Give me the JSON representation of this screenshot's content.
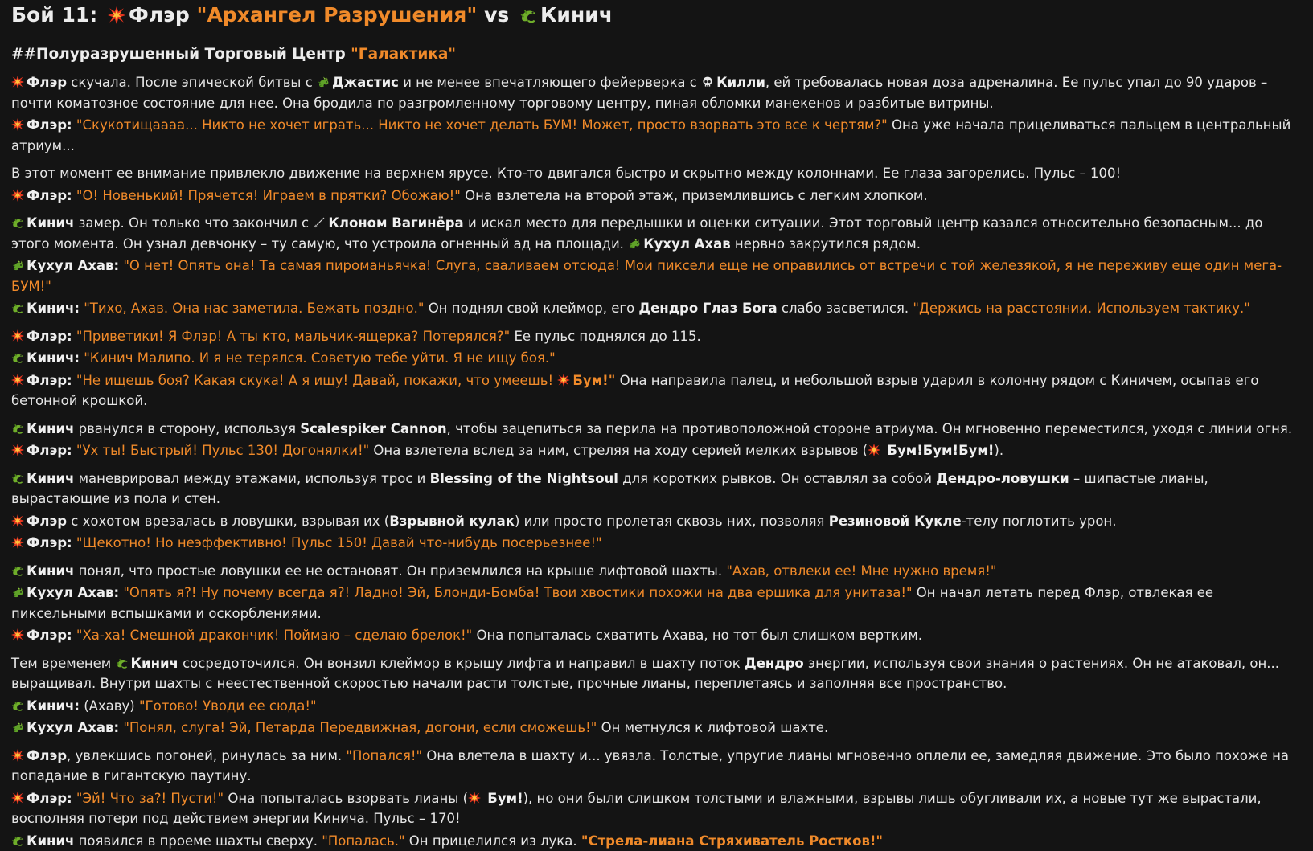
{
  "header": {
    "title_prefix": "Бой 11:",
    "fighter1": "Флэр",
    "fighter1_title": "\"Архангел Разрушения\"",
    "vs": "vs",
    "fighter2": "Кинич"
  },
  "location": {
    "prefix": "##Полуразрушенный Торговый Центр",
    "name": "\"Галактика\""
  },
  "icons": {
    "explosion": "explosion-icon",
    "lizard": "lizard-icon",
    "dragon": "dragon-icon",
    "skull": "skull-icon",
    "blade": "blade-icon"
  },
  "colors": {
    "accent": "#f08a2a",
    "text": "#e6e6e6",
    "background": "#141414"
  },
  "p1": {
    "l1a": "Флэр",
    "l1b": "скучала. После эпической битвы с",
    "l1c": "Джастис",
    "l1d": "и не менее впечатляющего фейерверка с",
    "l1e": "Килли",
    "l1f": ", ей требовалась новая доза адреналина. Ее пульс упал до 90 ударов – почти коматозное состояние для нее. Она бродила по разгромленному торговому центру, пиная обломки манекенов и разбитые витрины.",
    "l2a": "Флэр:",
    "l2b": "\"Скукотищаааа... Никто не хочет играть... Никто не хочет делать БУМ! Может, просто взорвать это все к чертям?\"",
    "l2c": "Она уже начала прицеливаться пальцем в центральный атриум..."
  },
  "p2": {
    "l1": "В этот момент ее внимание привлекло движение на верхнем ярусе. Кто-то двигался быстро и скрытно между колоннами. Ее глаза загорелись. Пульс – 100!",
    "l2a": "Флэр:",
    "l2b": "\"О! Новенький! Прячется! Играем в прятки? Обожаю!\"",
    "l2c": "Она взлетела на второй этаж, приземлившись с легким хлопком."
  },
  "p3": {
    "l1a": "Кинич",
    "l1b": "замер. Он только что закончил с",
    "l1c": "Клоном Вагинёра",
    "l1d": "и искал место для передышки и оценки ситуации. Этот торговый центр казался относительно безопасным... до этого момента. Он узнал девчонку – ту самую, что устроила огненный ад на площади.",
    "l1e": "Кухул Ахав",
    "l1f": "нервно закрутился рядом.",
    "l2a": "Кухул Ахав:",
    "l2b": "\"О нет! Опять она! Та самая пироманьячка! Слуга, сваливаем отсюда! Мои пиксели еще не оправились от встречи с той железякой, я не переживу еще один мега-БУМ!\"",
    "l3a": "Кинич:",
    "l3b": "\"Тихо, Ахав. Она нас заметила. Бежать поздно.\"",
    "l3c": "Он поднял свой клеймор, его",
    "l3d": "Дендро Глаз Бога",
    "l3e": "слабо засветился.",
    "l3f": "\"Держись на расстоянии. Используем тактику.\""
  },
  "p4": {
    "l1a": "Флэр:",
    "l1b": "\"Приветики! Я Флэр! А ты кто, мальчик-ящерка? Потерялся?\"",
    "l1c": "Ее пульс поднялся до 115.",
    "l2a": "Кинич:",
    "l2b": "\"Кинич Малипо. И я не терялся. Советую тебе уйти. Я не ищу боя.\"",
    "l3a": "Флэр:",
    "l3b": "\"Не ищешь боя? Какая скука! А я ищу! Давай, покажи, что умеешь!",
    "l3c": "Бум!\"",
    "l3d": "Она направила палец, и небольшой взрыв ударил в колонну рядом с Киничем, осыпав его бетонной крошкой."
  },
  "p5": {
    "l1a": "Кинич",
    "l1b": "рванулся в сторону, используя",
    "l1c": "Scalespiker Cannon",
    "l1d": ", чтобы зацепиться за перила на противоположной стороне атриума. Он мгновенно переместился, уходя с линии огня.",
    "l2a": "Флэр:",
    "l2b": "\"Ух ты! Быстрый! Пульс 130! Догонялки!\"",
    "l2c": "Она взлетела вслед за ним, стреляя на ходу серией мелких взрывов (",
    "l2d": "Бум!Бум!Бум!",
    "l2e": ")."
  },
  "p6": {
    "l1a": "Кинич",
    "l1b": "маневрировал между этажами, используя трос и",
    "l1c": "Blessing of the Nightsoul",
    "l1d": "для коротких рывков. Он оставлял за собой",
    "l1e": "Дендро-ловушки",
    "l1f": "– шипастые лианы, вырастающие из пола и стен.",
    "l2a": "Флэр",
    "l2b": "с хохотом врезалась в ловушки, взрывая их (",
    "l2c": "Взрывной кулак",
    "l2d": ") или просто пролетая сквозь них, позволяя",
    "l2e": "Резиновой Кукле",
    "l2f": "-телу поглотить урон.",
    "l3a": "Флэр:",
    "l3b": "\"Щекотно! Но неэффективно! Пульс 150! Давай что-нибудь посерьезнее!\""
  },
  "p7": {
    "l1a": "Кинич",
    "l1b": "понял, что простые ловушки ее не остановят. Он приземлился на крыше лифтовой шахты.",
    "l1c": "\"Ахав, отвлеки ее! Мне нужно время!\"",
    "l2a": "Кухул Ахав:",
    "l2b": "\"Опять я?! Ну почему всегда я?! Ладно! Эй, Блонди-Бомба! Твои хвостики похожи на два ершика для унитаза!\"",
    "l2c": "Он начал летать перед Флэр, отвлекая ее пиксельными вспышками и оскорблениями.",
    "l3a": "Флэр:",
    "l3b": "\"Ха-ха! Смешной дракончик! Поймаю – сделаю брелок!\"",
    "l3c": "Она попыталась схватить Ахава, но тот был слишком вертким."
  },
  "p8": {
    "l1a": "Тем временем",
    "l1b": "Кинич",
    "l1c": "сосредоточился. Он вонзил клеймор в крышу лифта и направил в шахту поток",
    "l1d": "Дендро",
    "l1e": "энергии, используя свои знания о растениях. Он не атаковал, он... выращивал. Внутри шахты с неестественной скоростью начали расти толстые, прочные лианы, переплетаясь и заполняя все пространство.",
    "l2a": "Кинич:",
    "l2b": "(Ахаву)",
    "l2c": "\"Готово! Уводи ее сюда!\"",
    "l3a": "Кухул Ахав:",
    "l3b": "\"Понял, слуга! Эй, Петарда Передвижная, догони, если сможешь!\"",
    "l3c": "Он метнулся к лифтовой шахте."
  },
  "p9": {
    "l1a": "Флэр",
    "l1b": ", увлекшись погоней, ринулась за ним.",
    "l1c": "\"Попался!\"",
    "l1d": "Она влетела в шахту и... увязла. Толстые, упругие лианы мгновенно оплели ее, замедляя движение. Это было похоже на попадание в гигантскую паутину.",
    "l2a": "Флэр:",
    "l2b": "\"Эй! Что за?! Пусти!\"",
    "l2c": "Она попыталась взорвать лианы (",
    "l2d": "Бум!",
    "l2e": "), но они были слишком толстыми и влажными, взрывы лишь обугливали их, а новые тут же вырастали, восполняя потери под действием энергии Кинича. Пульс – 170!",
    "l3a": "Кинич",
    "l3b": "появился в проеме шахты сверху.",
    "l3c": "\"Попалась.\"",
    "l3d": "Он прицелился из лука.",
    "l3e": "\"Стрела-лиана Стряхиватель Ростков!\""
  }
}
